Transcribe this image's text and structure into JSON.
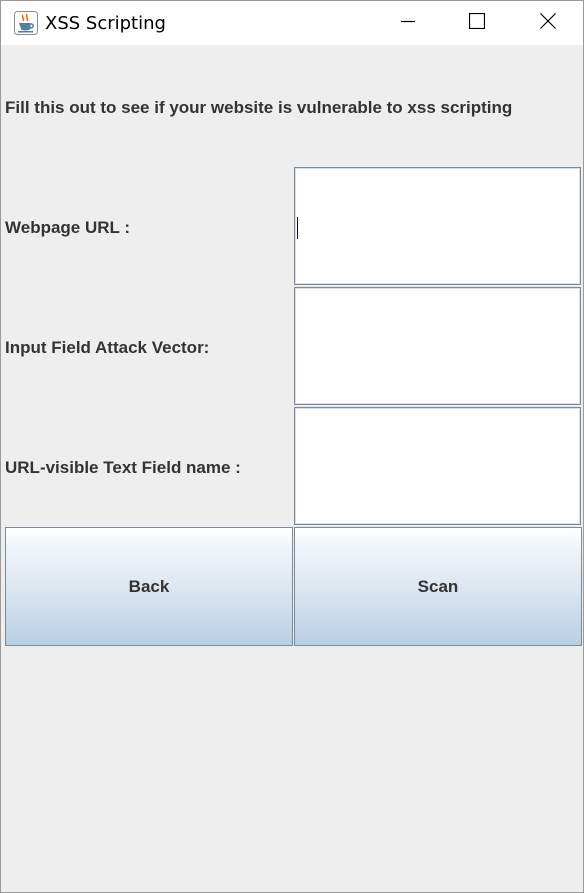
{
  "window": {
    "title": "XSS Scripting",
    "icon": "java-coffee-cup-icon"
  },
  "titlebar_buttons": {
    "minimize": "minimize-icon",
    "maximize": "maximize-icon",
    "close": "close-icon"
  },
  "form": {
    "intro": "Fill this out to see if your website is vulnerable to xss scripting",
    "fields": [
      {
        "label": "Webpage URL :",
        "value": ""
      },
      {
        "label": "Input Field Attack Vector:",
        "value": ""
      },
      {
        "label": "URL-visible Text Field name :",
        "value": ""
      }
    ]
  },
  "buttons": {
    "back": "Back",
    "scan": "Scan"
  },
  "colors": {
    "window_bg": "#eeeeee",
    "titlebar_bg": "#ffffff",
    "label_text": "#333333",
    "button_gradient_top": "#ffffff",
    "button_gradient_bottom": "#b8cfe4",
    "border": "#7a8a99"
  }
}
